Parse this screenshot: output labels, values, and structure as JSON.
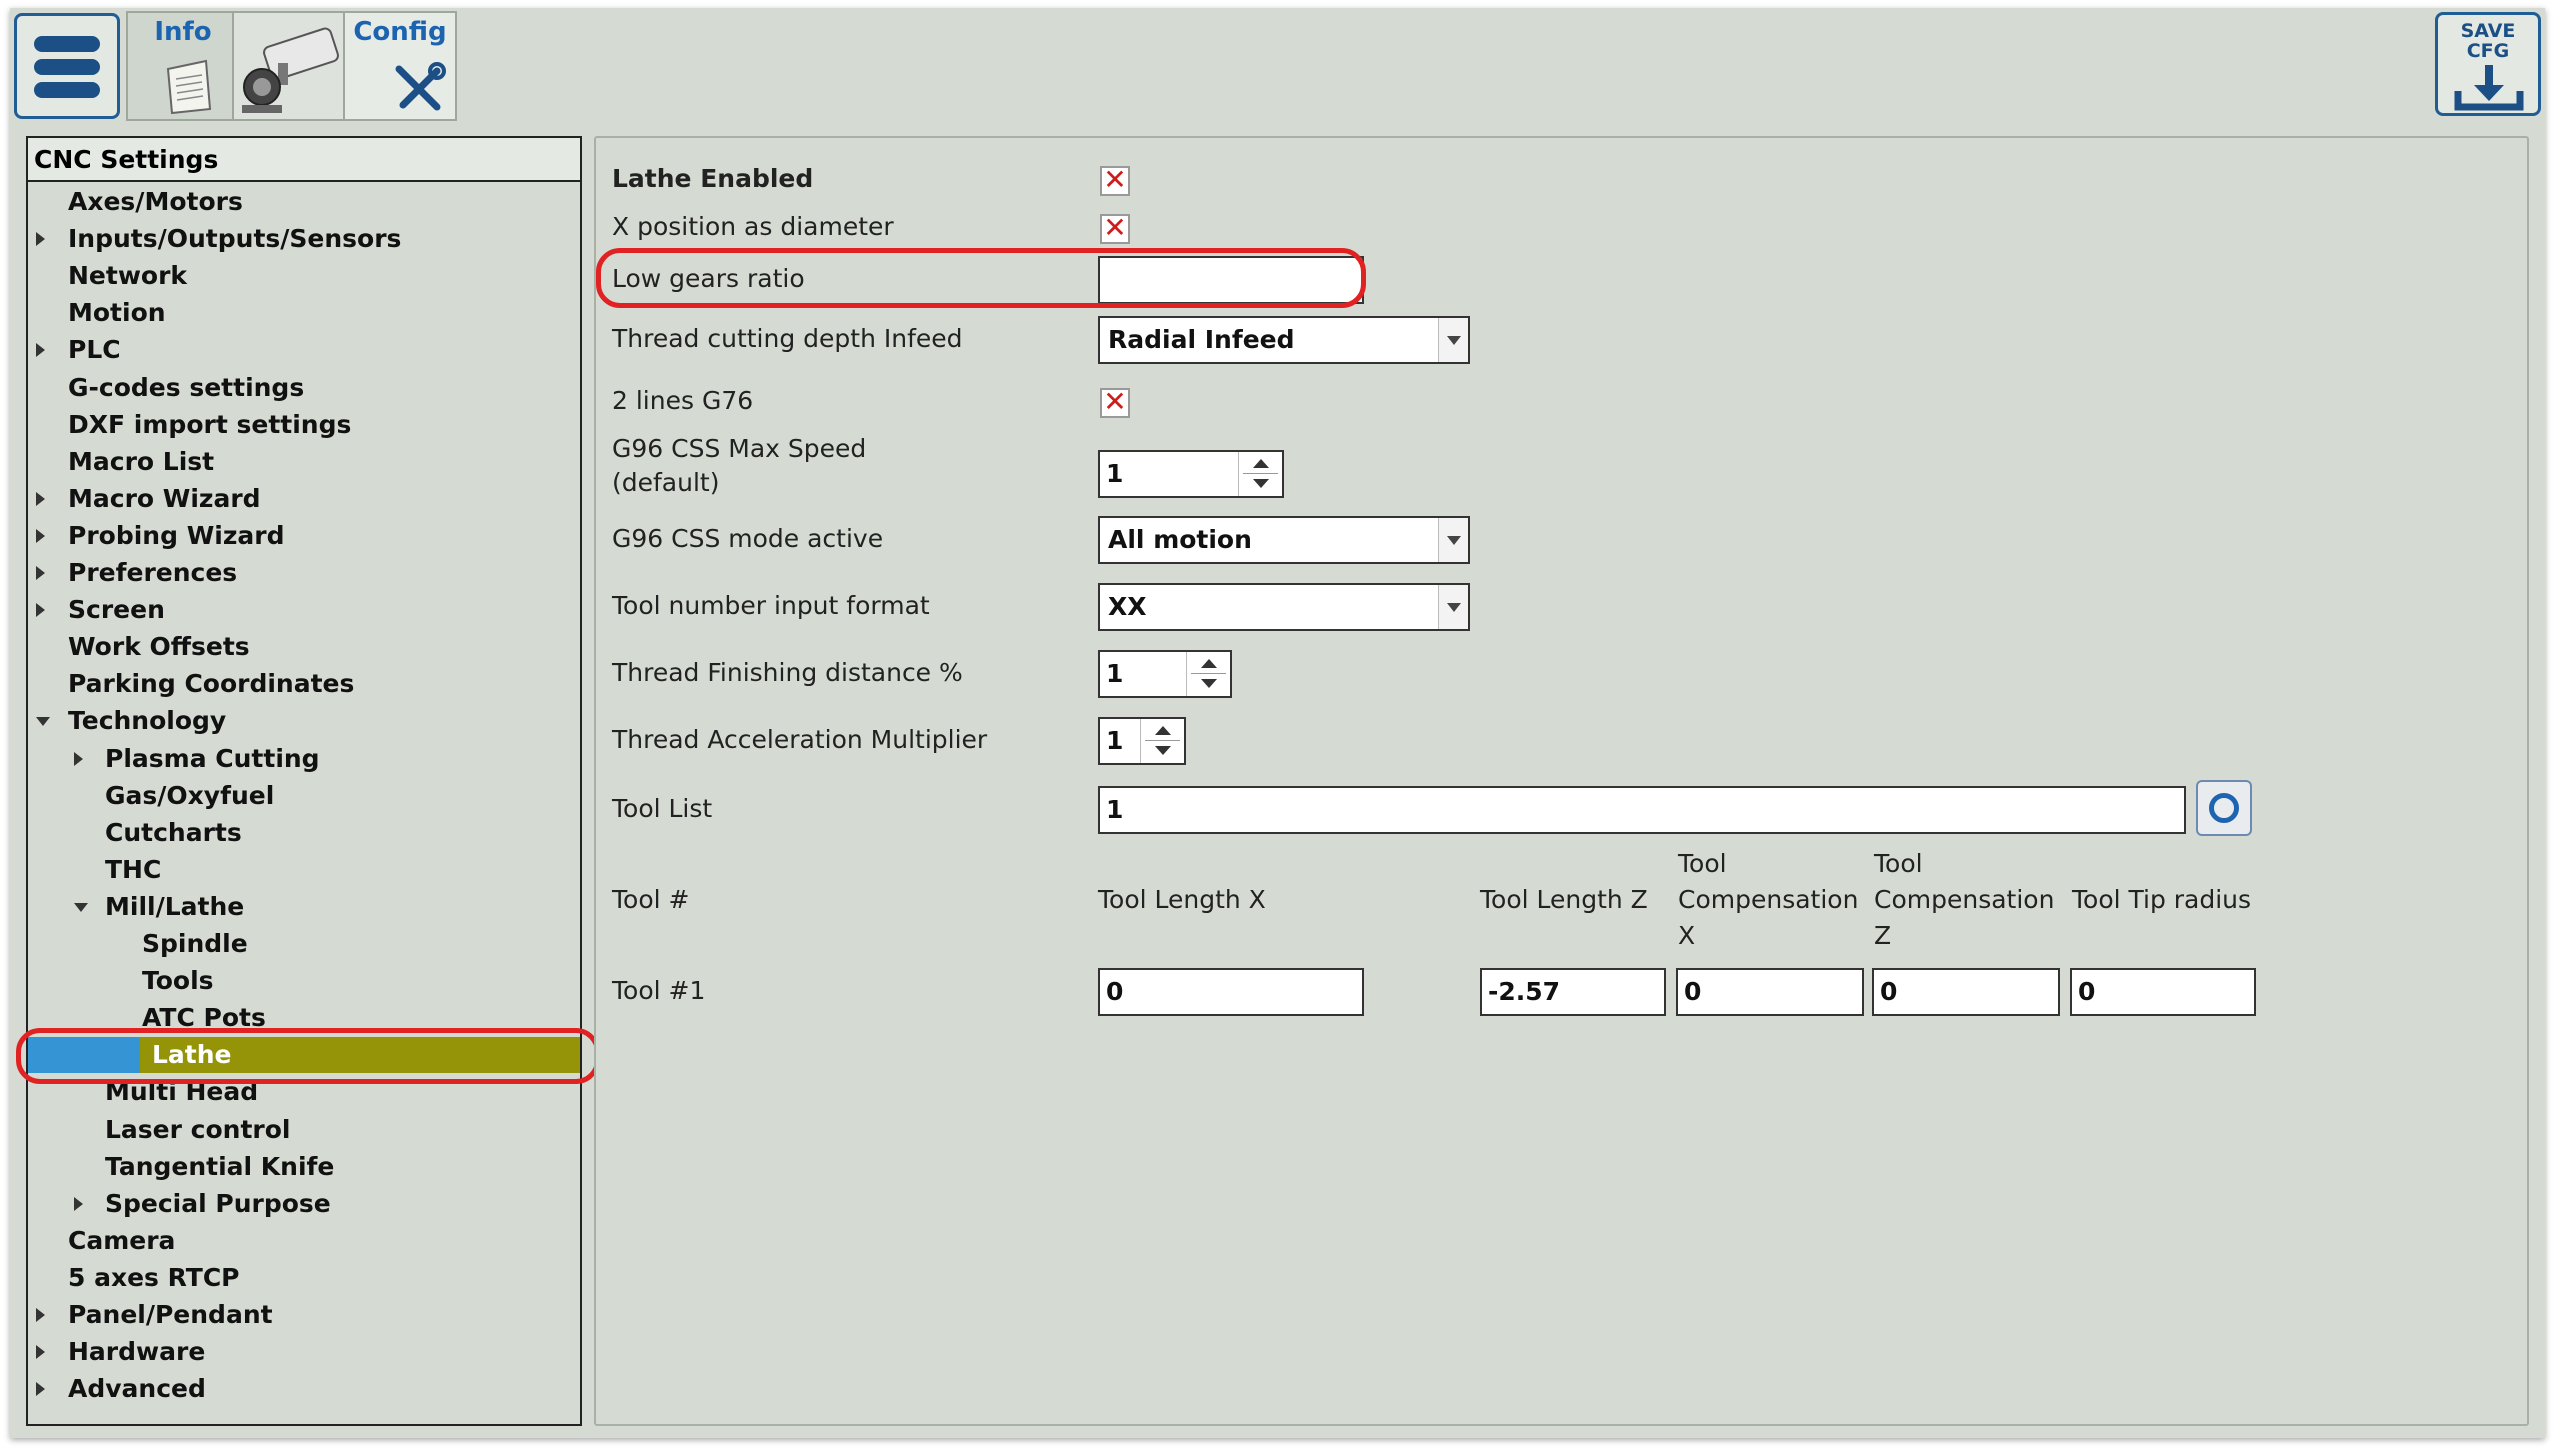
{
  "toolbar": {
    "info_label": "Info",
    "config_label": "Config",
    "save_label_line1": "SAVE",
    "save_label_line2": "CFG"
  },
  "tree": {
    "header": "CNC Settings",
    "items": [
      {
        "label": "Axes/Motors",
        "expander": "none",
        "level": 1
      },
      {
        "label": "Inputs/Outputs/Sensors",
        "expander": "collapsed",
        "level": 1
      },
      {
        "label": "Network",
        "expander": "none",
        "level": 1
      },
      {
        "label": "Motion",
        "expander": "none",
        "level": 1
      },
      {
        "label": "PLC",
        "expander": "collapsed",
        "level": 1
      },
      {
        "label": "G-codes settings",
        "expander": "none",
        "level": 1
      },
      {
        "label": "DXF import settings",
        "expander": "none",
        "level": 1
      },
      {
        "label": "Macro List",
        "expander": "none",
        "level": 1
      },
      {
        "label": "Macro Wizard",
        "expander": "collapsed",
        "level": 1
      },
      {
        "label": "Probing Wizard",
        "expander": "collapsed",
        "level": 1
      },
      {
        "label": "Preferences",
        "expander": "collapsed",
        "level": 1
      },
      {
        "label": "Screen",
        "expander": "collapsed",
        "level": 1
      },
      {
        "label": "Work Offsets",
        "expander": "none",
        "level": 1
      },
      {
        "label": "Parking Coordinates",
        "expander": "none",
        "level": 1
      },
      {
        "label": "Technology",
        "expander": "expanded",
        "level": 1
      },
      {
        "label": "Plasma Cutting",
        "expander": "collapsed",
        "level": 2
      },
      {
        "label": "Gas/Oxyfuel",
        "expander": "none",
        "level": 2
      },
      {
        "label": "Cutcharts",
        "expander": "none",
        "level": 2
      },
      {
        "label": "THC",
        "expander": "none",
        "level": 2
      },
      {
        "label": "Mill/Lathe",
        "expander": "expanded",
        "level": 2
      },
      {
        "label": "Spindle",
        "expander": "none",
        "level": 3
      },
      {
        "label": "Tools",
        "expander": "none",
        "level": 3
      },
      {
        "label": "ATC Pots",
        "expander": "none",
        "level": 3
      },
      {
        "label": "Lathe",
        "expander": "none",
        "level": 3,
        "selected": true
      },
      {
        "label": "Multi Head",
        "expander": "none",
        "level": 2
      },
      {
        "label": "Laser control",
        "expander": "none",
        "level": 2
      },
      {
        "label": "Tangential Knife",
        "expander": "none",
        "level": 2
      },
      {
        "label": "Special Purpose",
        "expander": "collapsed",
        "level": 2
      },
      {
        "label": "Camera",
        "expander": "none",
        "level": 1
      },
      {
        "label": "5 axes RTCP",
        "expander": "none",
        "level": 1
      },
      {
        "label": "Panel/Pendant",
        "expander": "collapsed",
        "level": 1
      },
      {
        "label": "Hardware",
        "expander": "collapsed",
        "level": 1
      },
      {
        "label": "Advanced",
        "expander": "collapsed",
        "level": 1
      }
    ]
  },
  "settings": {
    "lathe_enabled": {
      "label": "Lathe Enabled",
      "checked": true
    },
    "x_as_diameter": {
      "label": "X position as diameter",
      "checked": true
    },
    "low_gears_ratio": {
      "label": "Low gears ratio",
      "value": ""
    },
    "thread_depth_infeed": {
      "label": "Thread cutting depth Infeed",
      "value": "Radial Infeed"
    },
    "two_lines_g76": {
      "label": "2 lines G76",
      "checked": true
    },
    "g96_max_speed": {
      "label_line1": "G96 CSS Max Speed",
      "label_line2": "(default)",
      "value": "1"
    },
    "g96_mode": {
      "label": "G96 CSS mode active",
      "value": "All motion"
    },
    "tool_number_format": {
      "label": "Tool number input format",
      "value": "XX"
    },
    "thread_finishing": {
      "label": "Thread Finishing distance %",
      "value": "1"
    },
    "thread_accel": {
      "label": "Thread Acceleration Multiplier",
      "value": "1"
    },
    "tool_list": {
      "label": "Tool List",
      "value": "1"
    }
  },
  "tool_table": {
    "headers": {
      "tool_num": "Tool #",
      "length_x": "Tool Length X",
      "length_z": "Tool Length Z",
      "comp_x_line1": "Tool",
      "comp_x_line2": "Compensation",
      "comp_x_line3": "X",
      "comp_z_line1": "Tool",
      "comp_z_line2": "Compensation",
      "comp_z_line3": "Z",
      "tip_radius": "Tool Tip radius"
    },
    "rows": [
      {
        "name": "Tool #1",
        "length_x": "0",
        "length_z": "-2.57",
        "comp_x": "0",
        "comp_z": "0",
        "tip_radius": "0"
      }
    ]
  },
  "checkbox_mark": "✕",
  "colors": {
    "background": "#d5dbd3",
    "accent_blue": "#1d64b0",
    "selection_olive": "#959408",
    "selection_blue": "#3594d4",
    "highlight_red": "#e02222",
    "check_red": "#d01b1b"
  }
}
